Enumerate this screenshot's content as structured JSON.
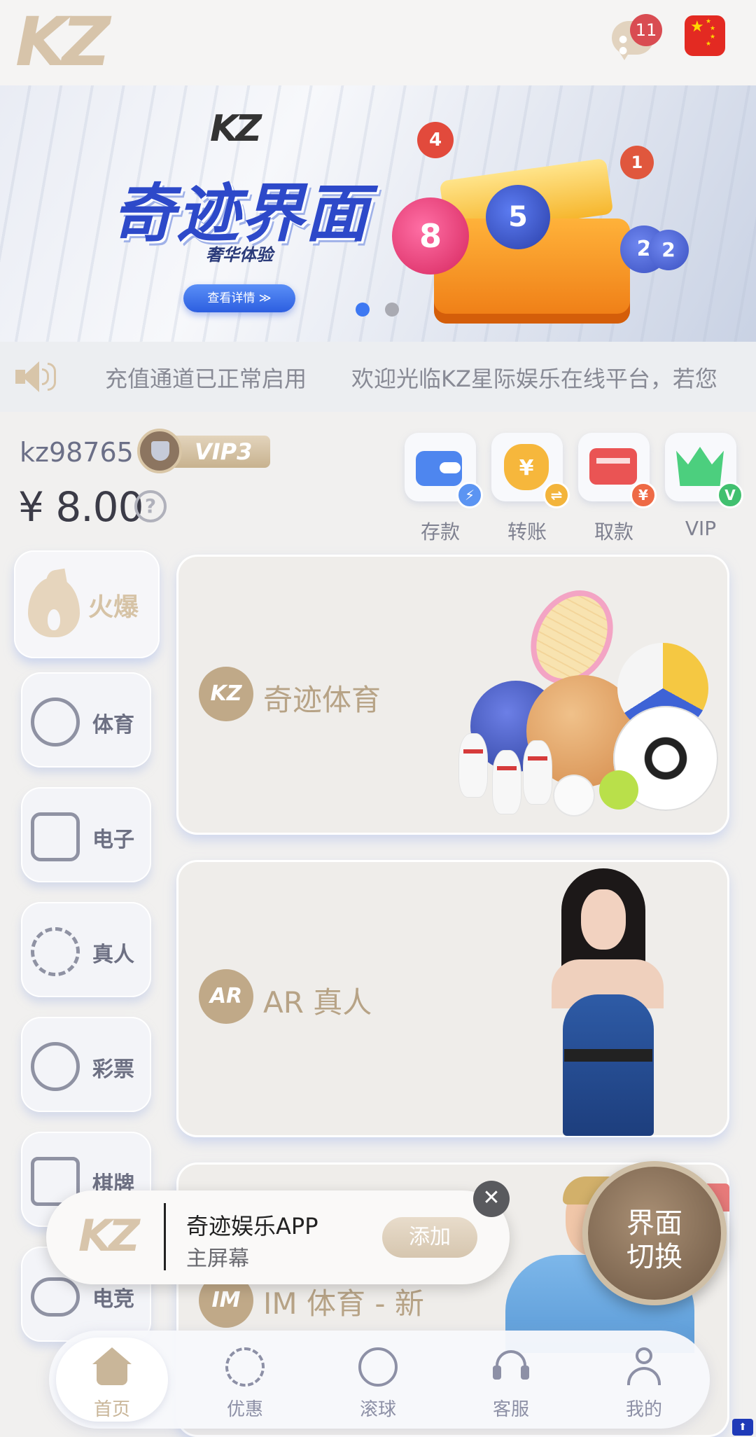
{
  "header": {
    "logo_text": "KZ",
    "messages_badge": "11",
    "language_flag": "china-flag-icon"
  },
  "banner": {
    "brand": "KZ",
    "title": "奇迹界面",
    "subtitle": "奢华体验",
    "cta_label": "查看详情 ≫",
    "balls": [
      "4",
      "1",
      "5",
      "8",
      "2",
      "2"
    ],
    "slide_count": 2,
    "active_slide": 1
  },
  "marquee": {
    "icon": "speaker-icon",
    "text": "充值通道已正常启用　　欢迎光临KZ星际娱乐在线平台，若您"
  },
  "account": {
    "username": "kz98765",
    "vip_level": "VIP3",
    "balance": "¥ 8.00",
    "help_symbol": "?"
  },
  "quick_actions": [
    {
      "label": "存款",
      "icon": "wallet-icon",
      "color": "#4e86ef"
    },
    {
      "label": "转账",
      "icon": "money-bag-icon",
      "color": "#f6b73c"
    },
    {
      "label": "取款",
      "icon": "card-icon",
      "color": "#ea5454"
    },
    {
      "label": "VIP",
      "icon": "crown-icon",
      "color": "#4ccf7e"
    }
  ],
  "side_nav": [
    {
      "label": "火爆",
      "icon": "flame-icon",
      "active": true
    },
    {
      "label": "体育",
      "icon": "soccer-icon"
    },
    {
      "label": "电子",
      "icon": "slot-machine-icon"
    },
    {
      "label": "真人",
      "icon": "poker-chip-icon"
    },
    {
      "label": "彩票",
      "icon": "lottery-ball-icon"
    },
    {
      "label": "棋牌",
      "icon": "cards-icon"
    },
    {
      "label": "电竞",
      "icon": "gamepad-icon"
    }
  ],
  "game_cards": [
    {
      "title": "奇迹体育",
      "logo": "KZ"
    },
    {
      "title": "AR 真人",
      "logo": "AR"
    },
    {
      "title": "IM 体育 - 新",
      "logo": "IM"
    }
  ],
  "toggle_fab": {
    "line1": "界面",
    "line2": "切换"
  },
  "a2hs": {
    "logo": "KZ",
    "title": "奇迹娱乐APP",
    "subtitle": "主屏幕",
    "add_label": "添加",
    "close_symbol": "✕"
  },
  "bottom_nav": [
    {
      "label": "首页",
      "icon": "home-icon",
      "active": true
    },
    {
      "label": "优惠",
      "icon": "promo-badge-icon"
    },
    {
      "label": "滚球",
      "icon": "live-ball-icon"
    },
    {
      "label": "客服",
      "icon": "headset-icon"
    },
    {
      "label": "我的",
      "icon": "user-icon"
    }
  ]
}
